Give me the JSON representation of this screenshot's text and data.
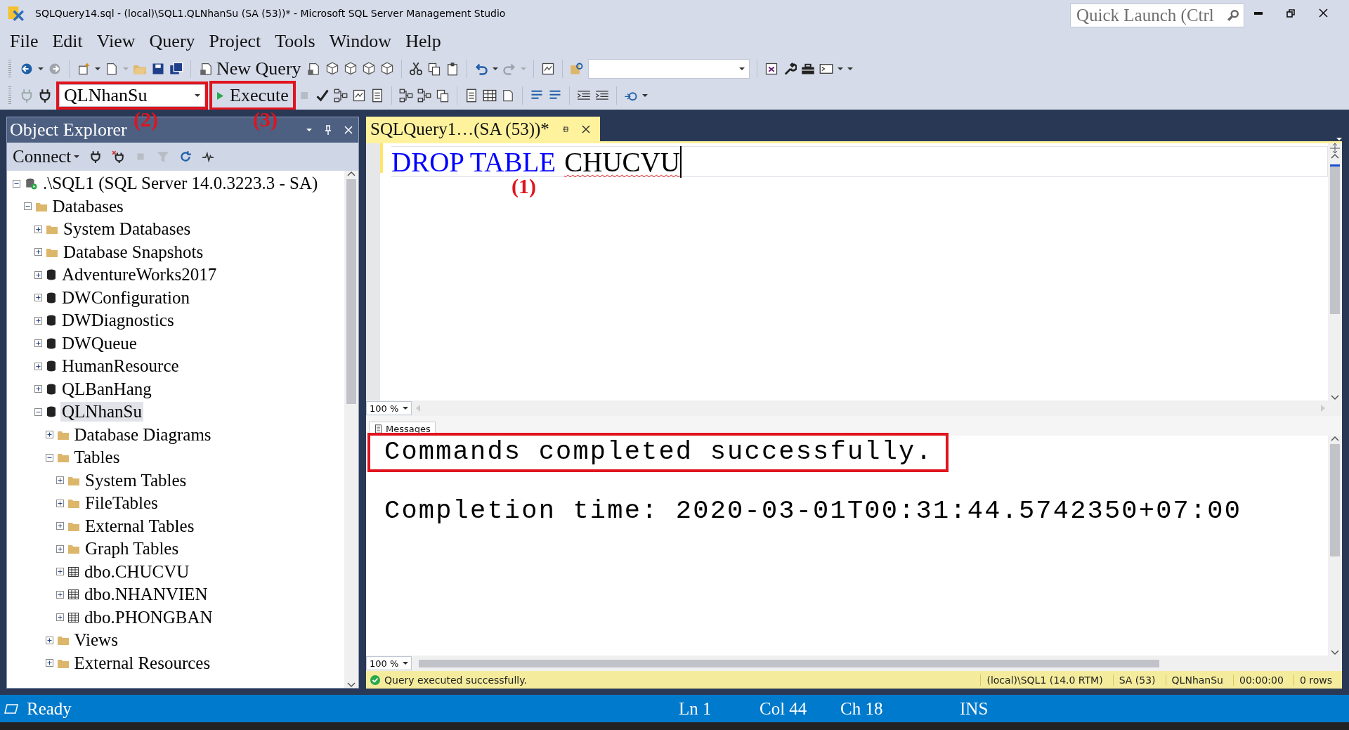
{
  "window": {
    "title": "SQLQuery14.sql - (local)\\SQL1.QLNhanSu (SA (53))* - Microsoft SQL Server Management Studio",
    "quick_launch": {
      "placeholder": "Quick Launch (Ctrl"
    }
  },
  "menu": [
    "File",
    "Edit",
    "View",
    "Query",
    "Project",
    "Tools",
    "Window",
    "Help"
  ],
  "toolbar": {
    "new_query": "New Query",
    "database": "QLNhanSu",
    "database_highlighted": true,
    "execute": "Execute",
    "execute_highlighted": true
  },
  "annotations": {
    "database": "(2)",
    "execute": "(3)",
    "editor": "(1)"
  },
  "object_explorer": {
    "title": "Object Explorer",
    "connect": "Connect",
    "tree": [
      {
        "label": ".\\SQL1 (SQL Server 14.0.3223.3 - SA)",
        "kind": "server",
        "expanded": true,
        "selected": false,
        "children": [
          {
            "label": "Databases",
            "kind": "folder",
            "expanded": true,
            "selected": false,
            "children": [
              {
                "label": "System Databases",
                "kind": "folder",
                "expanded": false,
                "selected": false
              },
              {
                "label": "Database Snapshots",
                "kind": "folder",
                "expanded": false,
                "selected": false
              },
              {
                "label": "AdventureWorks2017",
                "kind": "database",
                "expanded": false,
                "selected": false
              },
              {
                "label": "DWConfiguration",
                "kind": "database",
                "expanded": false,
                "selected": false
              },
              {
                "label": "DWDiagnostics",
                "kind": "database",
                "expanded": false,
                "selected": false
              },
              {
                "label": "DWQueue",
                "kind": "database",
                "expanded": false,
                "selected": false
              },
              {
                "label": "HumanResource",
                "kind": "database",
                "expanded": false,
                "selected": false
              },
              {
                "label": "QLBanHang",
                "kind": "database",
                "expanded": false,
                "selected": false
              },
              {
                "label": "QLNhanSu",
                "kind": "database",
                "expanded": true,
                "selected": true,
                "children": [
                  {
                    "label": "Database Diagrams",
                    "kind": "folder",
                    "expanded": false,
                    "selected": false
                  },
                  {
                    "label": "Tables",
                    "kind": "folder",
                    "expanded": true,
                    "selected": false,
                    "children": [
                      {
                        "label": "System Tables",
                        "kind": "folder",
                        "expanded": false,
                        "selected": false
                      },
                      {
                        "label": "FileTables",
                        "kind": "folder",
                        "expanded": false,
                        "selected": false
                      },
                      {
                        "label": "External Tables",
                        "kind": "folder",
                        "expanded": false,
                        "selected": false
                      },
                      {
                        "label": "Graph Tables",
                        "kind": "folder",
                        "expanded": false,
                        "selected": false
                      },
                      {
                        "label": "dbo.CHUCVU",
                        "kind": "table",
                        "expanded": false,
                        "selected": false
                      },
                      {
                        "label": "dbo.NHANVIEN",
                        "kind": "table",
                        "expanded": false,
                        "selected": false
                      },
                      {
                        "label": "dbo.PHONGBAN",
                        "kind": "table",
                        "expanded": false,
                        "selected": false
                      }
                    ]
                  },
                  {
                    "label": "Views",
                    "kind": "folder",
                    "expanded": false,
                    "selected": false
                  },
                  {
                    "label": "External Resources",
                    "kind": "folder",
                    "expanded": false,
                    "selected": false
                  }
                ]
              }
            ]
          }
        ]
      }
    ]
  },
  "editor": {
    "tab": {
      "label": "SQLQuery1…(SA (53))*",
      "selected": true
    },
    "code": [
      {
        "text": "DROP TABLE",
        "kind": "keyword"
      },
      {
        "text": "CHUCVU",
        "kind": "error"
      }
    ],
    "zoom": "100 %"
  },
  "results": {
    "tabs": [
      {
        "label": "Messages",
        "selected": true
      }
    ],
    "messages": [
      {
        "text": "Commands completed successfully.",
        "highlighted": true
      },
      {
        "text": "Completion time: 2020-03-01T00:31:44.5742350+07:00",
        "highlighted": false
      }
    ],
    "zoom": "100 %"
  },
  "query_status": {
    "message": "Query executed successfully.",
    "fields": [
      "(local)\\SQL1 (14.0 RTM)",
      "SA (53)",
      "QLNhanSu",
      "00:00:00",
      "0 rows"
    ]
  },
  "status_bar": {
    "text": "Ready",
    "ln": "Ln 1",
    "col": "Col 44",
    "ch": "Ch 18",
    "mode": "INS"
  }
}
